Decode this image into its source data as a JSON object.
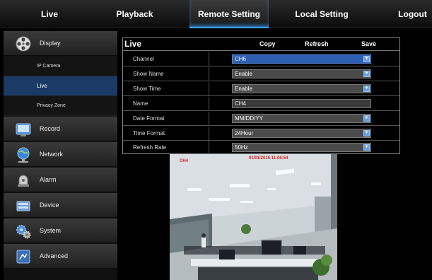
{
  "nav": {
    "tabs": [
      {
        "label": "Live"
      },
      {
        "label": "Playback"
      },
      {
        "label": "Remote Setting"
      },
      {
        "label": "Local Setting"
      },
      {
        "label": "Logout"
      }
    ],
    "active_index": 2
  },
  "sidebar": {
    "items": [
      {
        "label": "Display",
        "icon": "film-reel-icon"
      },
      {
        "label": "Record",
        "icon": "video-camera-icon"
      },
      {
        "label": "Network",
        "icon": "globe-network-icon"
      },
      {
        "label": "Alarm",
        "icon": "alarm-siren-icon"
      },
      {
        "label": "Device",
        "icon": "hard-drive-icon"
      },
      {
        "label": "System",
        "icon": "gears-icon"
      },
      {
        "label": "Advanced",
        "icon": "advanced-settings-icon"
      }
    ],
    "sub_items": [
      {
        "label": "IP Camera"
      },
      {
        "label": "Live"
      },
      {
        "label": "Privacy Zone"
      }
    ],
    "active_sub_index": 1
  },
  "panel": {
    "title": "Live",
    "copy_label": "Copy",
    "refresh_label": "Refresh",
    "save_label": "Save",
    "rows": [
      {
        "label": "Channel",
        "value": "CH6",
        "kind": "select"
      },
      {
        "label": "Show Name",
        "value": "Enable",
        "kind": "select"
      },
      {
        "label": "Show Time",
        "value": "Enable",
        "kind": "select"
      },
      {
        "label": "Name",
        "value": "CH4",
        "kind": "text"
      },
      {
        "label": "Date Format",
        "value": "MM/DD/YY",
        "kind": "select"
      },
      {
        "label": "Time Format",
        "value": "24Hour",
        "kind": "select"
      },
      {
        "label": "Refresh Rate",
        "value": "50Hz",
        "kind": "select"
      }
    ]
  },
  "preview": {
    "channel_osd": "CH4",
    "time_osd": "01/01/2015 11:06:54"
  },
  "colors": {
    "accent_blue": "#2f5fb3",
    "active_sidebar": "#1b3a66",
    "osd_red": "#e02020"
  }
}
